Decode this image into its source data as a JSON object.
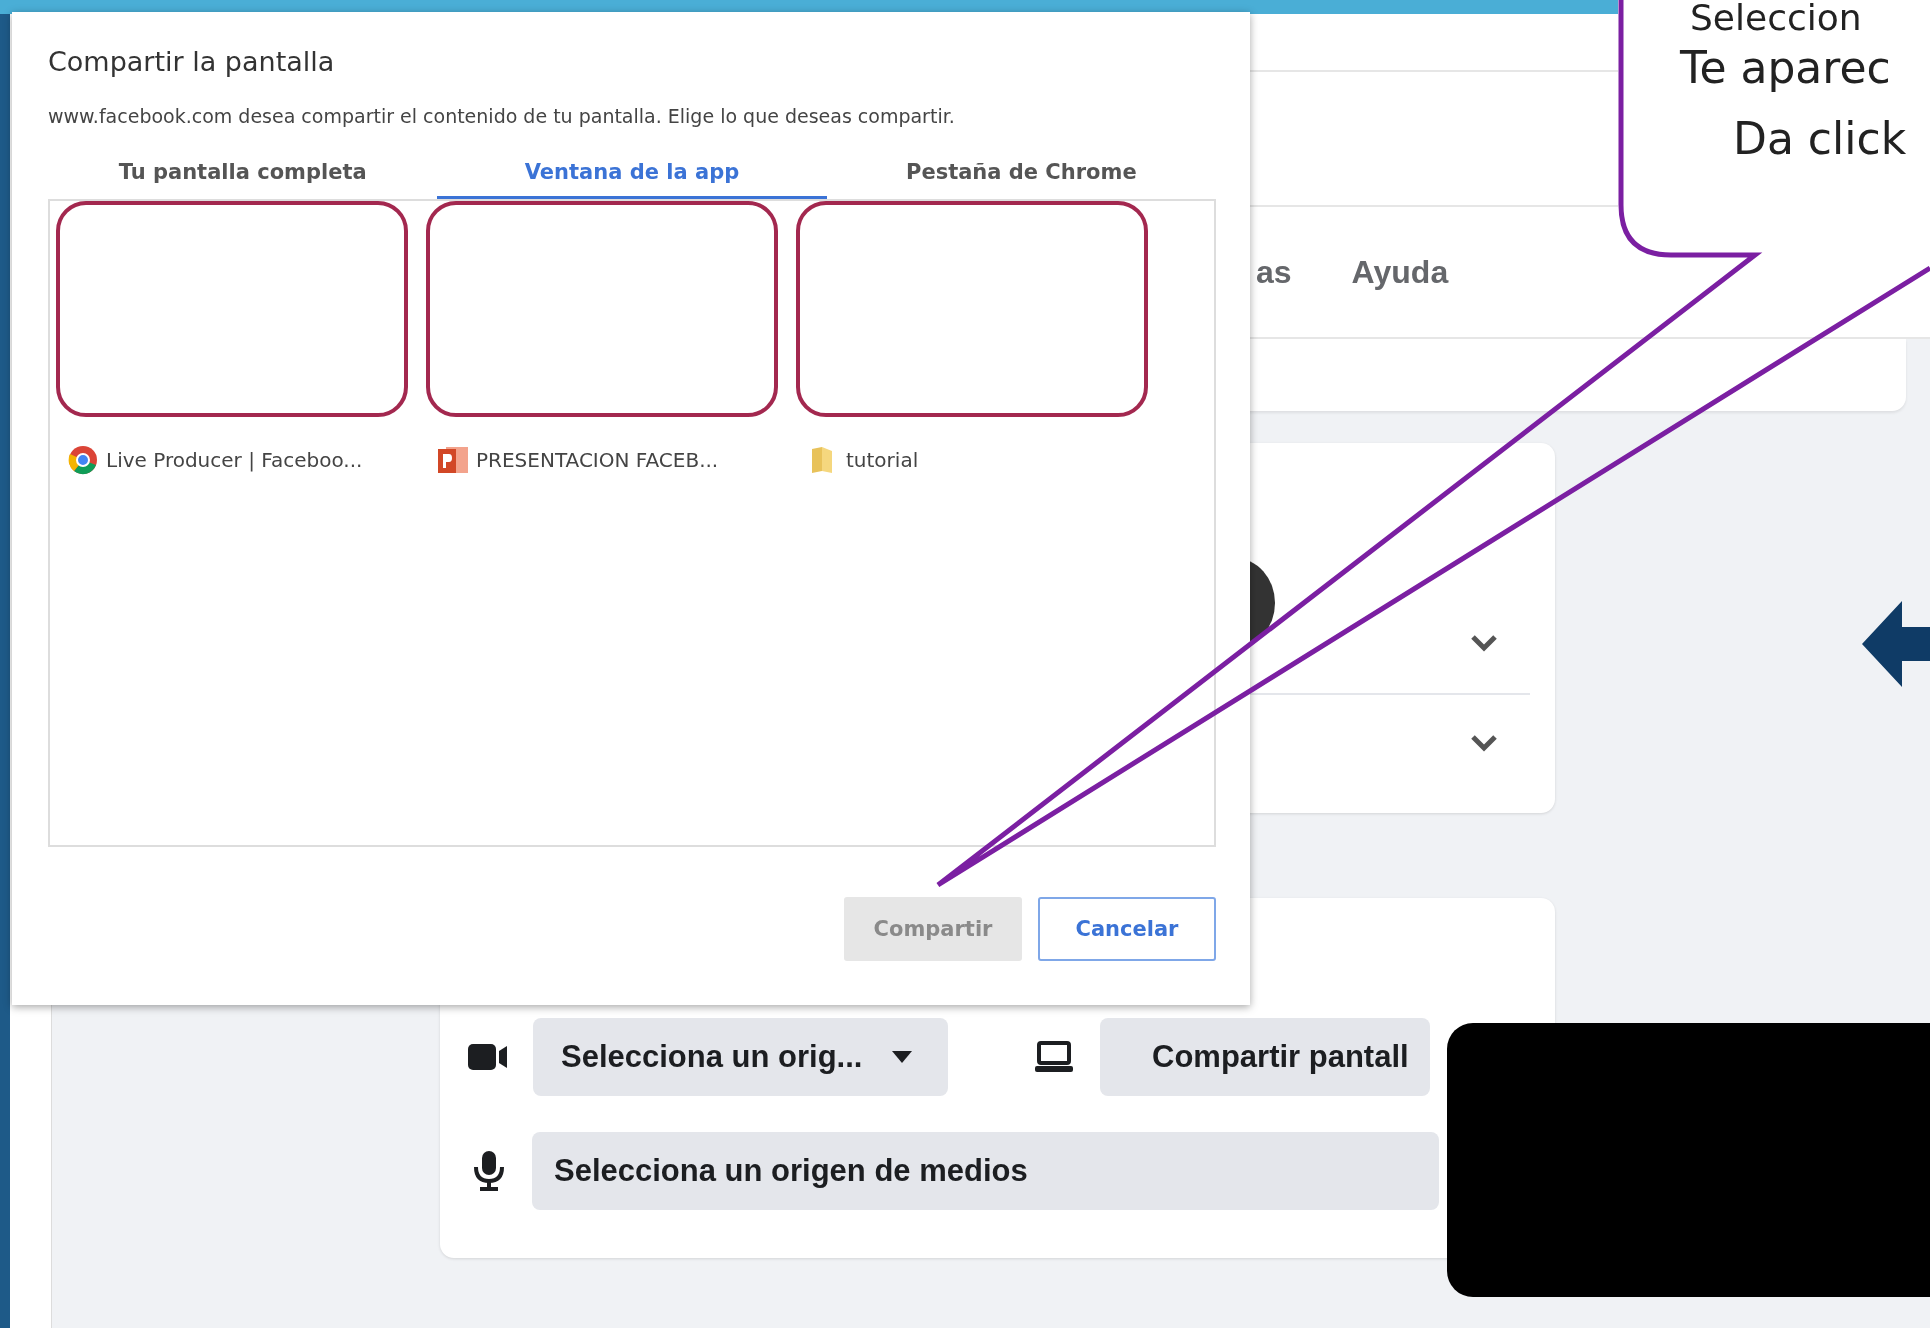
{
  "dialog": {
    "title": "Compartir la pantalla",
    "description": "www.facebook.com desea compartir el contenido de tu pantalla. Elige lo que deseas compartir.",
    "tabs": [
      {
        "label": "Tu pantalla completa",
        "selected": false
      },
      {
        "label": "Ventana de la app",
        "selected": true
      },
      {
        "label": "Pestaña de Chrome",
        "selected": false
      }
    ],
    "windows": [
      {
        "label": "Live Producer | Faceboo...",
        "kind": "browser"
      },
      {
        "label": "PRESENTACION FACEB...",
        "kind": "presentation"
      },
      {
        "label": "tutorial",
        "kind": "folder"
      }
    ],
    "buttons": [
      {
        "label": "Compartir",
        "disabled": true
      },
      {
        "label": "Cancelar",
        "disabled": false
      }
    ]
  },
  "background_page": {
    "nav_items": [
      "as",
      "Ayuda"
    ],
    "video_source": "Selecciona un orig...",
    "share_screen_button": "Compartir pantall",
    "audio_source": "Selecciona un origen de medios"
  },
  "callout": {
    "lines": [
      "Seleccion",
      "Te aparec",
      "Da click"
    ]
  }
}
